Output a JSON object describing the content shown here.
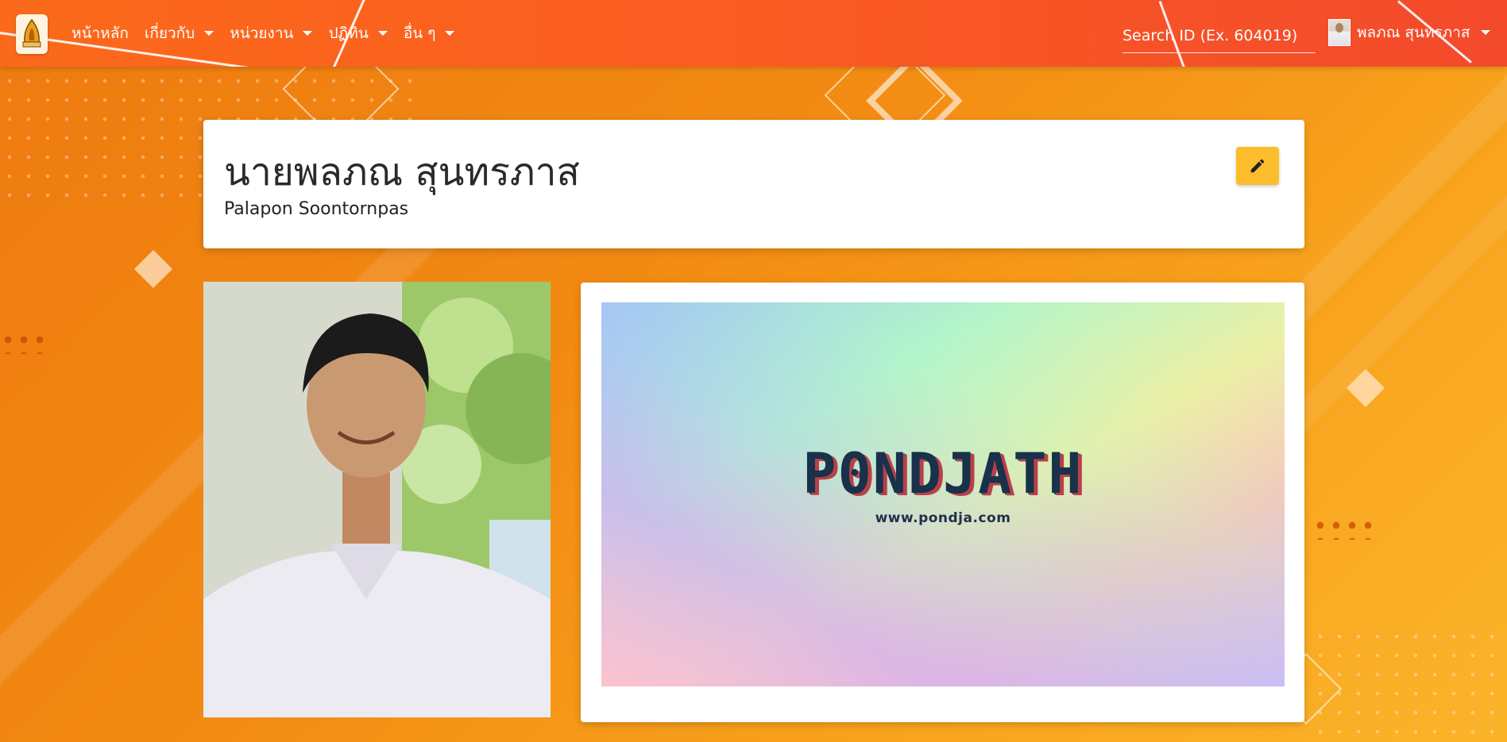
{
  "nav": {
    "items": [
      {
        "label": "หน้าหลัก",
        "dropdown": false
      },
      {
        "label": "เกี่ยวกับ",
        "dropdown": true
      },
      {
        "label": "หน่วยงาน",
        "dropdown": true
      },
      {
        "label": "ปฏิทิน",
        "dropdown": true
      },
      {
        "label": "อื่น ๆ",
        "dropdown": true
      }
    ],
    "search_placeholder": "Search ID (Ex. 604019)",
    "user_name": "พลภณ สุนทรภาส"
  },
  "profile": {
    "name_th": "นายพลภณ สุนทรภาส",
    "name_en": "Palapon Soontornpas"
  },
  "banner": {
    "brand": "P0NDJATH",
    "url": "www.pondja.com"
  },
  "colors": {
    "navbar": "#fa5b22",
    "background": "#f28a12",
    "edit_button": "#fbbd2c"
  },
  "icons": {
    "logo": "school-emblem-icon",
    "edit": "pencil-icon",
    "dropdown": "caret-down-icon"
  }
}
